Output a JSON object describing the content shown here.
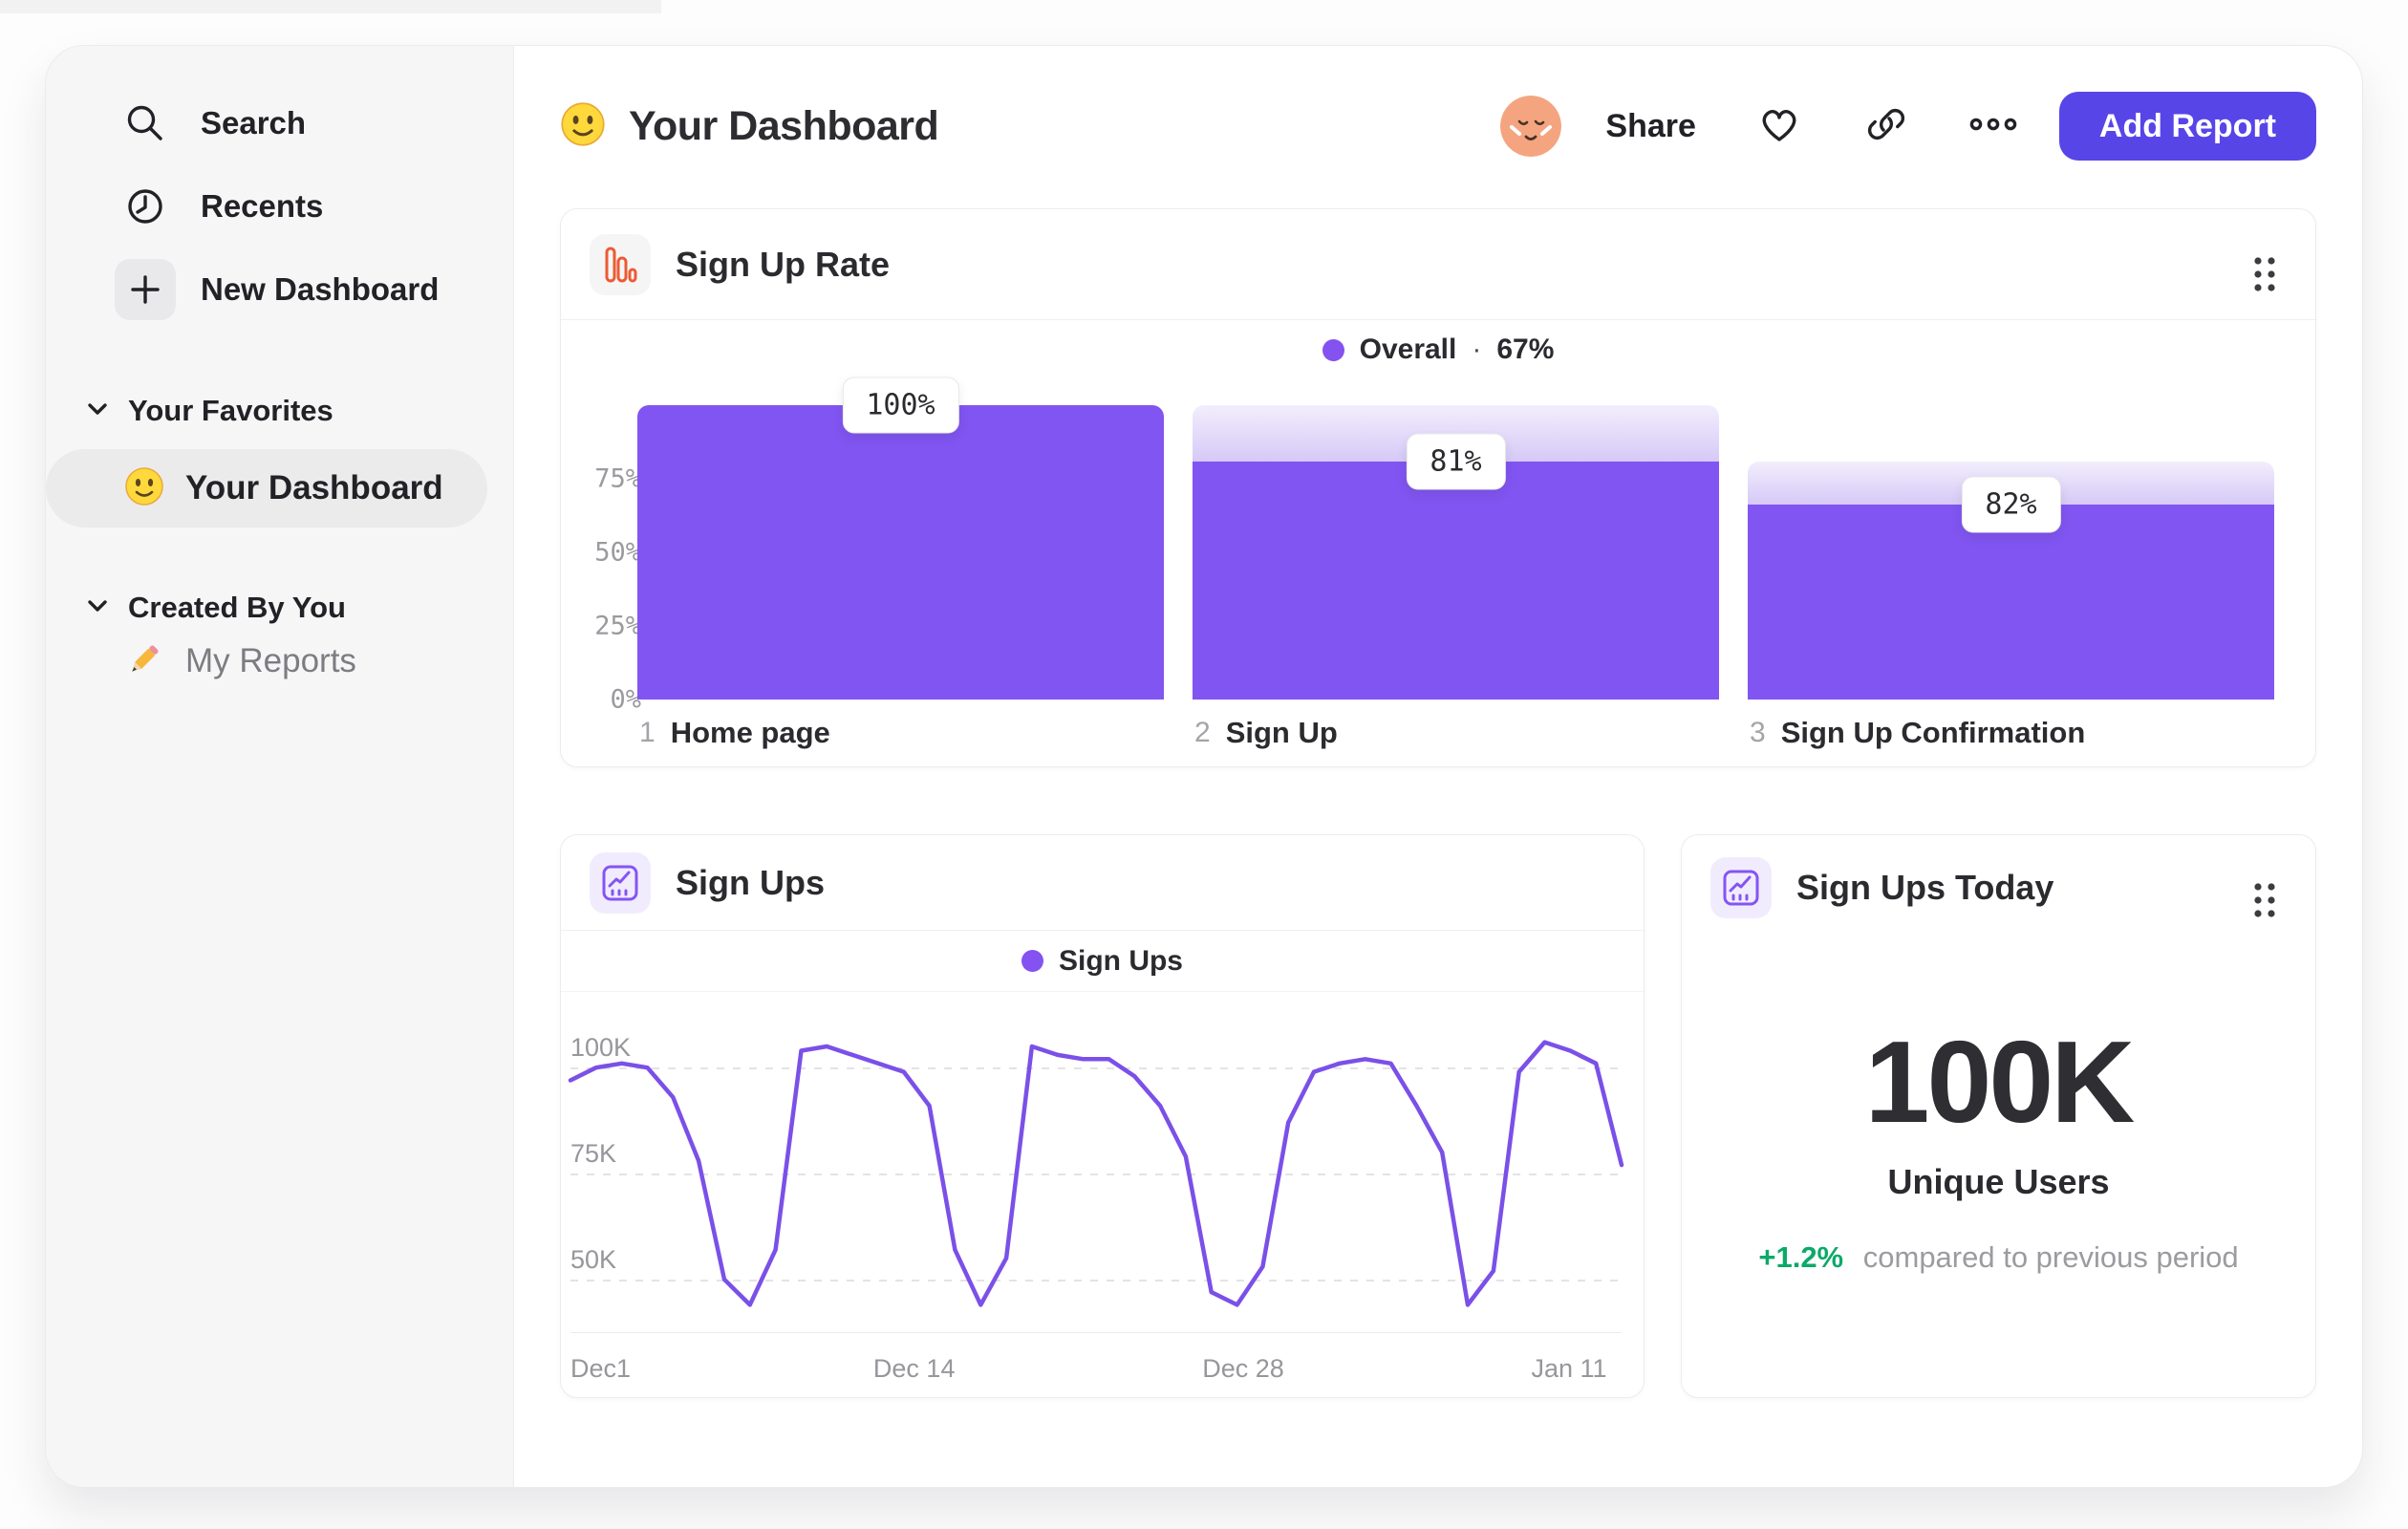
{
  "header": {
    "title": "Your Dashboard",
    "share": "Share",
    "add_report": "Add Report"
  },
  "sidebar": {
    "nav": [
      {
        "label": "Search"
      },
      {
        "label": "Recents"
      },
      {
        "label": "New Dashboard"
      }
    ],
    "sections": [
      {
        "title": "Your Favorites",
        "items": [
          {
            "label": "Your Dashboard",
            "selected": true
          }
        ]
      },
      {
        "title": "Created By You",
        "items": [
          {
            "label": "My Reports",
            "selected": false
          }
        ]
      }
    ]
  },
  "cards": {
    "funnel": {
      "title": "Sign Up Rate",
      "legend_label": "Overall",
      "legend_sep": "·",
      "legend_value": "67%"
    },
    "line": {
      "title": "Sign Ups",
      "legend_label": "Sign Ups"
    },
    "metric": {
      "title": "Sign Ups Today",
      "value": "100K",
      "label": "Unique Users",
      "delta": "+1.2%",
      "delta_note": "compared to previous period"
    }
  },
  "chart_data": [
    {
      "type": "bar",
      "variant": "funnel",
      "title": "Sign Up Rate",
      "legend": "Overall · 67%",
      "legend_position": "top-center",
      "categories": [
        "Home page",
        "Sign Up",
        "Sign Up Confirmation"
      ],
      "step_numbers": [
        "1",
        "2",
        "3"
      ],
      "values_overall_pct": [
        100,
        81,
        66.4
      ],
      "prev_overall_pct": [
        100,
        100,
        81
      ],
      "bar_labels": [
        "100%",
        "81%",
        "82%"
      ],
      "y_ticks": [
        {
          "label": "75%",
          "value": 75
        },
        {
          "label": "50%",
          "value": 50
        },
        {
          "label": "25%",
          "value": 25
        },
        {
          "label": "0%",
          "value": 0
        }
      ],
      "ylim": [
        0,
        100
      ],
      "grid": false,
      "bar_color": "#8155f1",
      "cap_gradient": [
        "#f2eefc",
        "#d6c9f7"
      ]
    },
    {
      "type": "line",
      "title": "Sign Ups",
      "legend": "Sign Ups",
      "legend_position": "top-center",
      "line_color": "#7b50e8",
      "unit": "K",
      "x_tick_labels": [
        "Dec1",
        "Dec 14",
        "Dec 28",
        "Jan 11"
      ],
      "x_tick_fractions": [
        0,
        0.327,
        0.64,
        0.95
      ],
      "y_ticks": [
        {
          "label": "100K",
          "value": 100
        },
        {
          "label": "75K",
          "value": 75
        },
        {
          "label": "50K",
          "value": 50
        }
      ],
      "ylim": [
        38,
        112
      ],
      "grid": "dashed-horizontal",
      "values": [
        97,
        100,
        101,
        100,
        93,
        78,
        50,
        44,
        57,
        104,
        105,
        103,
        101,
        99,
        91,
        57,
        44,
        55,
        105,
        103,
        102,
        102,
        98,
        91,
        79,
        47,
        44,
        53,
        87,
        99,
        101,
        102,
        101,
        91,
        80,
        44,
        52,
        99,
        106,
        104,
        101,
        77
      ]
    }
  ],
  "colors": {
    "accent_purple": "#5845e8",
    "bar_purple": "#8155f1",
    "line_purple": "#7b50e8",
    "legend_dot": "#8352f1",
    "icon_orange": "#ec5b33",
    "icon_purple": "#8455f4",
    "delta_green": "#0ca968",
    "avatar_orange": "#f4a57f",
    "sidebar_bg": "#f6f6f7"
  }
}
